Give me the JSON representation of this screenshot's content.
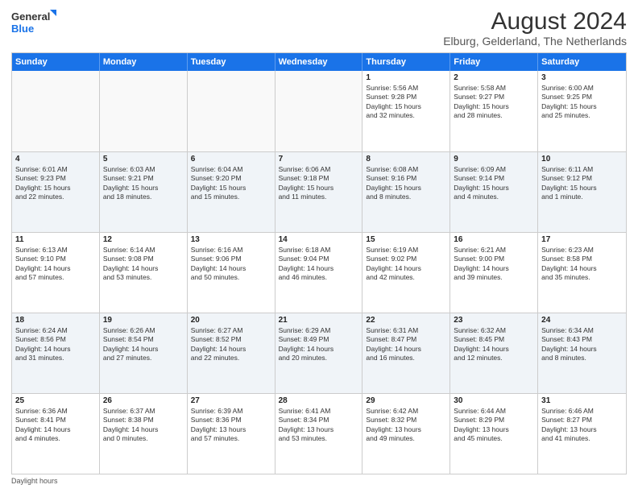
{
  "logo": {
    "line1": "General",
    "line2": "Blue"
  },
  "title": "August 2024",
  "location": "Elburg, Gelderland, The Netherlands",
  "headers": [
    "Sunday",
    "Monday",
    "Tuesday",
    "Wednesday",
    "Thursday",
    "Friday",
    "Saturday"
  ],
  "footer": "Daylight hours",
  "weeks": [
    [
      {
        "day": "",
        "info": ""
      },
      {
        "day": "",
        "info": ""
      },
      {
        "day": "",
        "info": ""
      },
      {
        "day": "",
        "info": ""
      },
      {
        "day": "1",
        "info": "Sunrise: 5:56 AM\nSunset: 9:28 PM\nDaylight: 15 hours\nand 32 minutes."
      },
      {
        "day": "2",
        "info": "Sunrise: 5:58 AM\nSunset: 9:27 PM\nDaylight: 15 hours\nand 28 minutes."
      },
      {
        "day": "3",
        "info": "Sunrise: 6:00 AM\nSunset: 9:25 PM\nDaylight: 15 hours\nand 25 minutes."
      }
    ],
    [
      {
        "day": "4",
        "info": "Sunrise: 6:01 AM\nSunset: 9:23 PM\nDaylight: 15 hours\nand 22 minutes."
      },
      {
        "day": "5",
        "info": "Sunrise: 6:03 AM\nSunset: 9:21 PM\nDaylight: 15 hours\nand 18 minutes."
      },
      {
        "day": "6",
        "info": "Sunrise: 6:04 AM\nSunset: 9:20 PM\nDaylight: 15 hours\nand 15 minutes."
      },
      {
        "day": "7",
        "info": "Sunrise: 6:06 AM\nSunset: 9:18 PM\nDaylight: 15 hours\nand 11 minutes."
      },
      {
        "day": "8",
        "info": "Sunrise: 6:08 AM\nSunset: 9:16 PM\nDaylight: 15 hours\nand 8 minutes."
      },
      {
        "day": "9",
        "info": "Sunrise: 6:09 AM\nSunset: 9:14 PM\nDaylight: 15 hours\nand 4 minutes."
      },
      {
        "day": "10",
        "info": "Sunrise: 6:11 AM\nSunset: 9:12 PM\nDaylight: 15 hours\nand 1 minute."
      }
    ],
    [
      {
        "day": "11",
        "info": "Sunrise: 6:13 AM\nSunset: 9:10 PM\nDaylight: 14 hours\nand 57 minutes."
      },
      {
        "day": "12",
        "info": "Sunrise: 6:14 AM\nSunset: 9:08 PM\nDaylight: 14 hours\nand 53 minutes."
      },
      {
        "day": "13",
        "info": "Sunrise: 6:16 AM\nSunset: 9:06 PM\nDaylight: 14 hours\nand 50 minutes."
      },
      {
        "day": "14",
        "info": "Sunrise: 6:18 AM\nSunset: 9:04 PM\nDaylight: 14 hours\nand 46 minutes."
      },
      {
        "day": "15",
        "info": "Sunrise: 6:19 AM\nSunset: 9:02 PM\nDaylight: 14 hours\nand 42 minutes."
      },
      {
        "day": "16",
        "info": "Sunrise: 6:21 AM\nSunset: 9:00 PM\nDaylight: 14 hours\nand 39 minutes."
      },
      {
        "day": "17",
        "info": "Sunrise: 6:23 AM\nSunset: 8:58 PM\nDaylight: 14 hours\nand 35 minutes."
      }
    ],
    [
      {
        "day": "18",
        "info": "Sunrise: 6:24 AM\nSunset: 8:56 PM\nDaylight: 14 hours\nand 31 minutes."
      },
      {
        "day": "19",
        "info": "Sunrise: 6:26 AM\nSunset: 8:54 PM\nDaylight: 14 hours\nand 27 minutes."
      },
      {
        "day": "20",
        "info": "Sunrise: 6:27 AM\nSunset: 8:52 PM\nDaylight: 14 hours\nand 22 minutes."
      },
      {
        "day": "21",
        "info": "Sunrise: 6:29 AM\nSunset: 8:49 PM\nDaylight: 14 hours\nand 20 minutes."
      },
      {
        "day": "22",
        "info": "Sunrise: 6:31 AM\nSunset: 8:47 PM\nDaylight: 14 hours\nand 16 minutes."
      },
      {
        "day": "23",
        "info": "Sunrise: 6:32 AM\nSunset: 8:45 PM\nDaylight: 14 hours\nand 12 minutes."
      },
      {
        "day": "24",
        "info": "Sunrise: 6:34 AM\nSunset: 8:43 PM\nDaylight: 14 hours\nand 8 minutes."
      }
    ],
    [
      {
        "day": "25",
        "info": "Sunrise: 6:36 AM\nSunset: 8:41 PM\nDaylight: 14 hours\nand 4 minutes."
      },
      {
        "day": "26",
        "info": "Sunrise: 6:37 AM\nSunset: 8:38 PM\nDaylight: 14 hours\nand 0 minutes."
      },
      {
        "day": "27",
        "info": "Sunrise: 6:39 AM\nSunset: 8:36 PM\nDaylight: 13 hours\nand 57 minutes."
      },
      {
        "day": "28",
        "info": "Sunrise: 6:41 AM\nSunset: 8:34 PM\nDaylight: 13 hours\nand 53 minutes."
      },
      {
        "day": "29",
        "info": "Sunrise: 6:42 AM\nSunset: 8:32 PM\nDaylight: 13 hours\nand 49 minutes."
      },
      {
        "day": "30",
        "info": "Sunrise: 6:44 AM\nSunset: 8:29 PM\nDaylight: 13 hours\nand 45 minutes."
      },
      {
        "day": "31",
        "info": "Sunrise: 6:46 AM\nSunset: 8:27 PM\nDaylight: 13 hours\nand 41 minutes."
      }
    ]
  ]
}
